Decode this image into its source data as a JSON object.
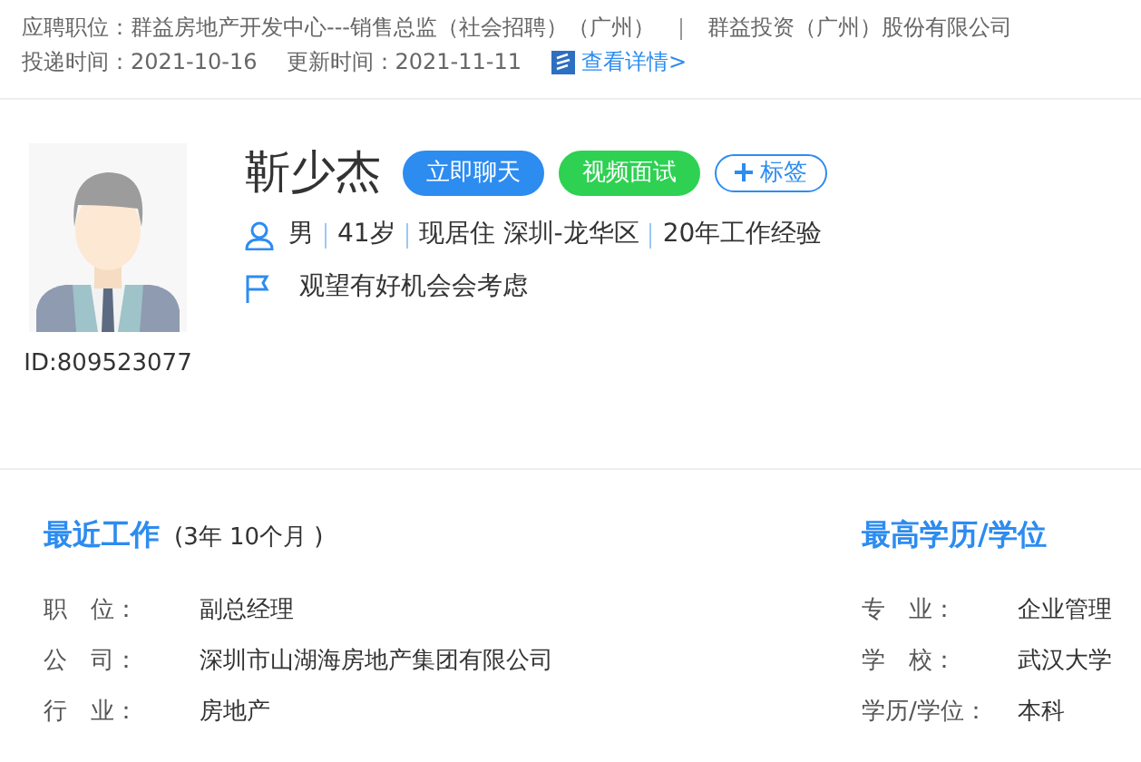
{
  "application": {
    "position_label": "应聘职位：",
    "position": "群益房地产开发中心---销售总监（社会招聘）（广州）",
    "company": "群益投资（广州）股份有限公司",
    "submitted": "投递时间：2021-10-16",
    "updated": "更新时间：2021-11-11",
    "details_link": "查看详情>"
  },
  "candidate": {
    "name": "靳少杰",
    "id": "ID:809523077",
    "actions": [
      {
        "label": "立即聊天",
        "kind": "chat"
      },
      {
        "label": "视频面试",
        "kind": "video"
      },
      {
        "label": "标签",
        "kind": "tag"
      }
    ],
    "facts": [
      "男",
      "41岁",
      "现居住 深圳-龙华区",
      "20年工作经验"
    ],
    "job_status": "观望有好机会会考虑"
  },
  "recent_work": {
    "title": "最近工作",
    "duration": "(3年 10个月 )",
    "fields": [
      {
        "label": "职　位：",
        "value": "副总经理"
      },
      {
        "label": "公　司：",
        "value": "深圳市山湖海房地产集团有限公司"
      },
      {
        "label": "行　业：",
        "value": "房地产"
      }
    ]
  },
  "education": {
    "title": "最高学历/学位",
    "fields": [
      {
        "label": "专　业：",
        "value": "企业管理"
      },
      {
        "label": "学　校：",
        "value": "武汉大学"
      },
      {
        "label": "学历/学位：",
        "value": "本科"
      }
    ]
  }
}
